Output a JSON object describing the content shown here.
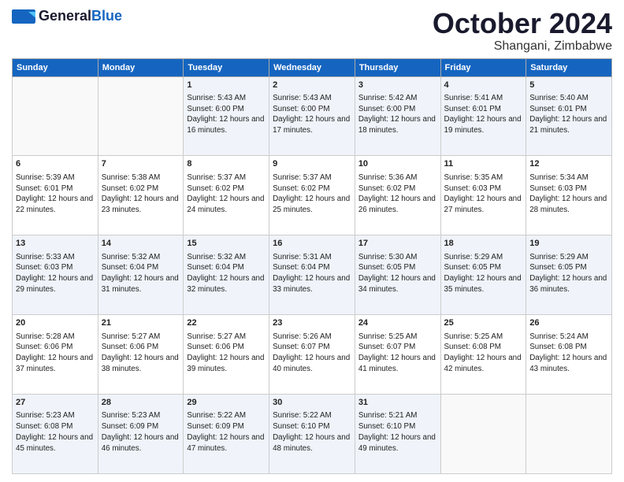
{
  "header": {
    "logo_line1": "General",
    "logo_line2": "Blue",
    "title": "October 2024",
    "subtitle": "Shangani, Zimbabwe"
  },
  "days_of_week": [
    "Sunday",
    "Monday",
    "Tuesday",
    "Wednesday",
    "Thursday",
    "Friday",
    "Saturday"
  ],
  "weeks": [
    [
      {
        "day": "",
        "sunrise": "",
        "sunset": "",
        "daylight": ""
      },
      {
        "day": "",
        "sunrise": "",
        "sunset": "",
        "daylight": ""
      },
      {
        "day": "1",
        "sunrise": "Sunrise: 5:43 AM",
        "sunset": "Sunset: 6:00 PM",
        "daylight": "Daylight: 12 hours and 16 minutes."
      },
      {
        "day": "2",
        "sunrise": "Sunrise: 5:43 AM",
        "sunset": "Sunset: 6:00 PM",
        "daylight": "Daylight: 12 hours and 17 minutes."
      },
      {
        "day": "3",
        "sunrise": "Sunrise: 5:42 AM",
        "sunset": "Sunset: 6:00 PM",
        "daylight": "Daylight: 12 hours and 18 minutes."
      },
      {
        "day": "4",
        "sunrise": "Sunrise: 5:41 AM",
        "sunset": "Sunset: 6:01 PM",
        "daylight": "Daylight: 12 hours and 19 minutes."
      },
      {
        "day": "5",
        "sunrise": "Sunrise: 5:40 AM",
        "sunset": "Sunset: 6:01 PM",
        "daylight": "Daylight: 12 hours and 21 minutes."
      }
    ],
    [
      {
        "day": "6",
        "sunrise": "Sunrise: 5:39 AM",
        "sunset": "Sunset: 6:01 PM",
        "daylight": "Daylight: 12 hours and 22 minutes."
      },
      {
        "day": "7",
        "sunrise": "Sunrise: 5:38 AM",
        "sunset": "Sunset: 6:02 PM",
        "daylight": "Daylight: 12 hours and 23 minutes."
      },
      {
        "day": "8",
        "sunrise": "Sunrise: 5:37 AM",
        "sunset": "Sunset: 6:02 PM",
        "daylight": "Daylight: 12 hours and 24 minutes."
      },
      {
        "day": "9",
        "sunrise": "Sunrise: 5:37 AM",
        "sunset": "Sunset: 6:02 PM",
        "daylight": "Daylight: 12 hours and 25 minutes."
      },
      {
        "day": "10",
        "sunrise": "Sunrise: 5:36 AM",
        "sunset": "Sunset: 6:02 PM",
        "daylight": "Daylight: 12 hours and 26 minutes."
      },
      {
        "day": "11",
        "sunrise": "Sunrise: 5:35 AM",
        "sunset": "Sunset: 6:03 PM",
        "daylight": "Daylight: 12 hours and 27 minutes."
      },
      {
        "day": "12",
        "sunrise": "Sunrise: 5:34 AM",
        "sunset": "Sunset: 6:03 PM",
        "daylight": "Daylight: 12 hours and 28 minutes."
      }
    ],
    [
      {
        "day": "13",
        "sunrise": "Sunrise: 5:33 AM",
        "sunset": "Sunset: 6:03 PM",
        "daylight": "Daylight: 12 hours and 29 minutes."
      },
      {
        "day": "14",
        "sunrise": "Sunrise: 5:32 AM",
        "sunset": "Sunset: 6:04 PM",
        "daylight": "Daylight: 12 hours and 31 minutes."
      },
      {
        "day": "15",
        "sunrise": "Sunrise: 5:32 AM",
        "sunset": "Sunset: 6:04 PM",
        "daylight": "Daylight: 12 hours and 32 minutes."
      },
      {
        "day": "16",
        "sunrise": "Sunrise: 5:31 AM",
        "sunset": "Sunset: 6:04 PM",
        "daylight": "Daylight: 12 hours and 33 minutes."
      },
      {
        "day": "17",
        "sunrise": "Sunrise: 5:30 AM",
        "sunset": "Sunset: 6:05 PM",
        "daylight": "Daylight: 12 hours and 34 minutes."
      },
      {
        "day": "18",
        "sunrise": "Sunrise: 5:29 AM",
        "sunset": "Sunset: 6:05 PM",
        "daylight": "Daylight: 12 hours and 35 minutes."
      },
      {
        "day": "19",
        "sunrise": "Sunrise: 5:29 AM",
        "sunset": "Sunset: 6:05 PM",
        "daylight": "Daylight: 12 hours and 36 minutes."
      }
    ],
    [
      {
        "day": "20",
        "sunrise": "Sunrise: 5:28 AM",
        "sunset": "Sunset: 6:06 PM",
        "daylight": "Daylight: 12 hours and 37 minutes."
      },
      {
        "day": "21",
        "sunrise": "Sunrise: 5:27 AM",
        "sunset": "Sunset: 6:06 PM",
        "daylight": "Daylight: 12 hours and 38 minutes."
      },
      {
        "day": "22",
        "sunrise": "Sunrise: 5:27 AM",
        "sunset": "Sunset: 6:06 PM",
        "daylight": "Daylight: 12 hours and 39 minutes."
      },
      {
        "day": "23",
        "sunrise": "Sunrise: 5:26 AM",
        "sunset": "Sunset: 6:07 PM",
        "daylight": "Daylight: 12 hours and 40 minutes."
      },
      {
        "day": "24",
        "sunrise": "Sunrise: 5:25 AM",
        "sunset": "Sunset: 6:07 PM",
        "daylight": "Daylight: 12 hours and 41 minutes."
      },
      {
        "day": "25",
        "sunrise": "Sunrise: 5:25 AM",
        "sunset": "Sunset: 6:08 PM",
        "daylight": "Daylight: 12 hours and 42 minutes."
      },
      {
        "day": "26",
        "sunrise": "Sunrise: 5:24 AM",
        "sunset": "Sunset: 6:08 PM",
        "daylight": "Daylight: 12 hours and 43 minutes."
      }
    ],
    [
      {
        "day": "27",
        "sunrise": "Sunrise: 5:23 AM",
        "sunset": "Sunset: 6:08 PM",
        "daylight": "Daylight: 12 hours and 45 minutes."
      },
      {
        "day": "28",
        "sunrise": "Sunrise: 5:23 AM",
        "sunset": "Sunset: 6:09 PM",
        "daylight": "Daylight: 12 hours and 46 minutes."
      },
      {
        "day": "29",
        "sunrise": "Sunrise: 5:22 AM",
        "sunset": "Sunset: 6:09 PM",
        "daylight": "Daylight: 12 hours and 47 minutes."
      },
      {
        "day": "30",
        "sunrise": "Sunrise: 5:22 AM",
        "sunset": "Sunset: 6:10 PM",
        "daylight": "Daylight: 12 hours and 48 minutes."
      },
      {
        "day": "31",
        "sunrise": "Sunrise: 5:21 AM",
        "sunset": "Sunset: 6:10 PM",
        "daylight": "Daylight: 12 hours and 49 minutes."
      },
      {
        "day": "",
        "sunrise": "",
        "sunset": "",
        "daylight": ""
      },
      {
        "day": "",
        "sunrise": "",
        "sunset": "",
        "daylight": ""
      }
    ]
  ]
}
